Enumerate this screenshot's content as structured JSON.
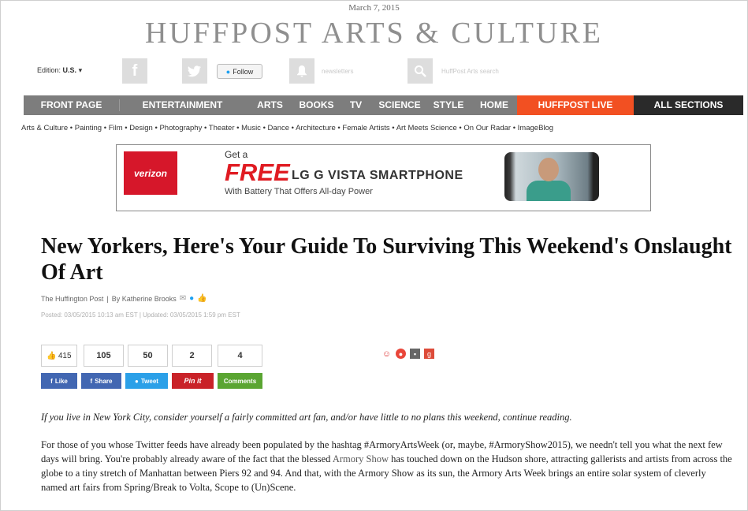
{
  "page": {
    "date": "March 7, 2015",
    "masthead": "HUFFPOST ARTS & CULTURE"
  },
  "utility": {
    "edition_label": "Edition:",
    "edition_value": "U.S.",
    "facebook_glyph": "f",
    "follow_label": "Follow",
    "search_placeholder": "HuffPost Arts search"
  },
  "nav": {
    "items": [
      "FRONT PAGE",
      "ENTERTAINMENT",
      "ARTS",
      "BOOKS",
      "TV",
      "SCIENCE",
      "STYLE",
      "HOME"
    ],
    "live": "HUFFPOST LIVE",
    "all": "ALL SECTIONS",
    "live_color": "#f25022"
  },
  "subnav": {
    "items": [
      "Arts & Culture",
      "Painting",
      "Film",
      "Design",
      "Photography",
      "Theater",
      "Music",
      "Dance",
      "Architecture",
      "Female Artists",
      "Art Meets Science",
      "On Our Radar",
      "ImageBlog"
    ]
  },
  "ad": {
    "brand": "verizon",
    "get_a": "Get a",
    "free": "FREE",
    "phone": "LG G VISTA SMARTPHONE",
    "line": "With Battery That Offers All-day Power"
  },
  "article": {
    "headline": "New Yorkers, Here's Your Guide To Surviving This Weekend's Onslaught Of Art",
    "byline_source": "The Huffington Post",
    "byline_author": "By Katherine Brooks",
    "posted": "Posted: 03/05/2015 10:13 am EST",
    "updated": "Updated: 03/05/2015 1:59 pm EST",
    "lede": "If you live in New York City, consider yourself a fairly committed art fan, and/or have little to no plans this weekend, continue reading.",
    "body_part1": "For those of you whose Twitter feeds have already been populated by the hashtag #ArmoryArtsWeek (or, maybe, #ArmoryShow2015), we needn't tell you what the next few days will bring. You're probably already aware of the fact that the blessed ",
    "body_link": "Armory Show",
    "body_part2": " has touched down on the Hudson shore, attracting gallerists and artists from across the globe to a tiny stretch of Manhattan between Piers 92 and 94. And that, with the Armory Show as its sun, the Armory Arts Week brings an entire solar system of cleverly named art fairs from Spring/Break to Volta, Scope to (Un)Scene."
  },
  "share": {
    "like_count": "415",
    "facebook_share_count": "105",
    "tweet_count": "50",
    "pin_count": "2",
    "comment_count": "4",
    "like_label": "Like",
    "share_label": "Share",
    "tweet_label": "Tweet",
    "pin_label": "Pin it",
    "comments_label": "Comments"
  }
}
